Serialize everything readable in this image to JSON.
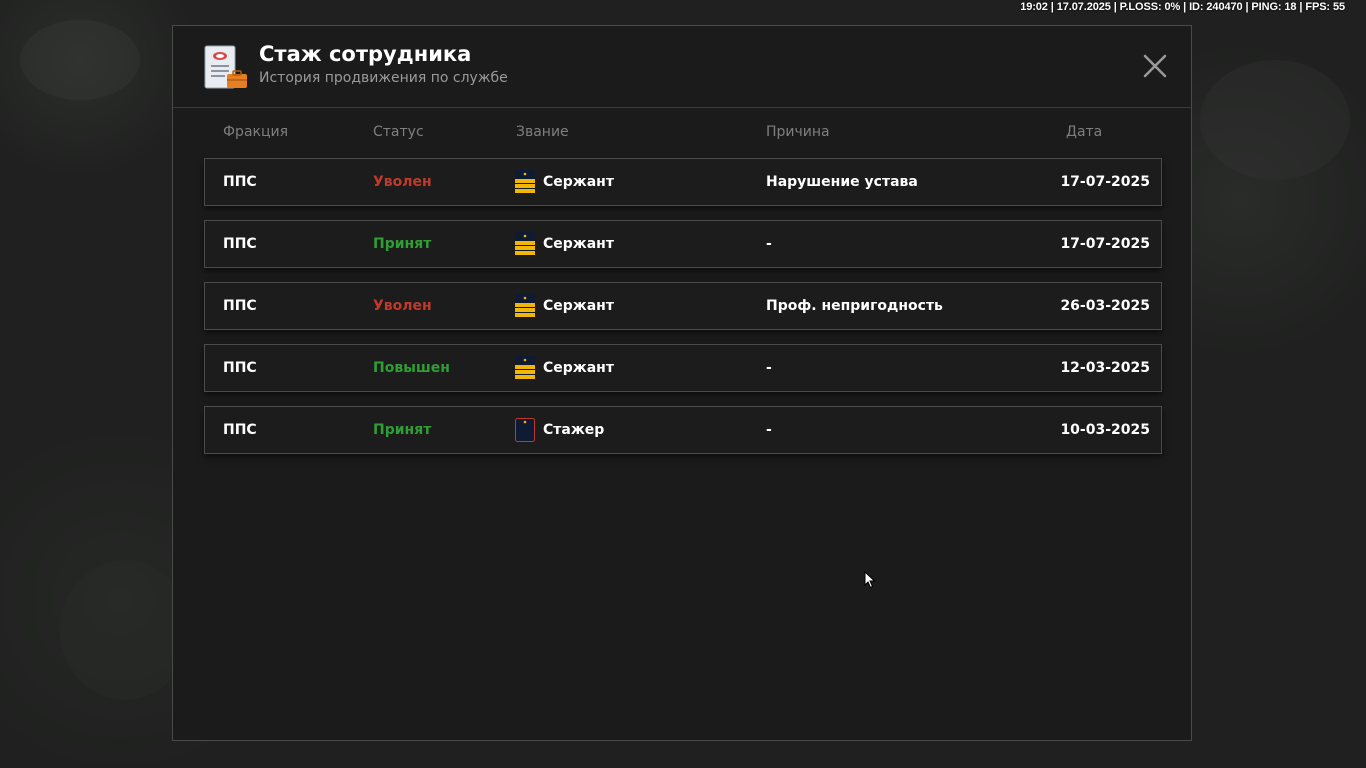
{
  "hud": {
    "text": "19:02 | 17.07.2025 | P.LOSS: 0% | ID: 240470 | PING: 18 | FPS: 55"
  },
  "modal": {
    "title": "Стаж сотрудника",
    "subtitle": "История продвижения по службе",
    "icon": "document-briefcase-icon",
    "close_icon": "close-icon"
  },
  "columns": {
    "faction": "Фракция",
    "status": "Статус",
    "rank": "Звание",
    "reason": "Причина",
    "date": "Дата"
  },
  "colors": {
    "fired": "#c0392b",
    "accepted": "#2f9e35",
    "accent_gold": "#e6b422"
  },
  "rows": [
    {
      "faction": "ППС",
      "status": "Уволен",
      "status_type": "fired",
      "rank": "Сержант",
      "rank_icon": "sergeant-shoulder-board-icon",
      "reason": "Нарушение устава",
      "date": "17-07-2025"
    },
    {
      "faction": "ППС",
      "status": "Принят",
      "status_type": "accepted",
      "rank": "Сержант",
      "rank_icon": "sergeant-shoulder-board-icon",
      "reason": "-",
      "date": "17-07-2025"
    },
    {
      "faction": "ППС",
      "status": "Уволен",
      "status_type": "fired",
      "rank": "Сержант",
      "rank_icon": "sergeant-shoulder-board-icon",
      "reason": "Проф. непригодность",
      "date": "26-03-2025"
    },
    {
      "faction": "ППС",
      "status": "Повышен",
      "status_type": "accepted",
      "rank": "Сержант",
      "rank_icon": "sergeant-shoulder-board-icon",
      "reason": "-",
      "date": "12-03-2025"
    },
    {
      "faction": "ППС",
      "status": "Принят",
      "status_type": "accepted",
      "rank": "Стажер",
      "rank_icon": "trainee-shoulder-board-icon",
      "reason": "-",
      "date": "10-03-2025"
    }
  ]
}
